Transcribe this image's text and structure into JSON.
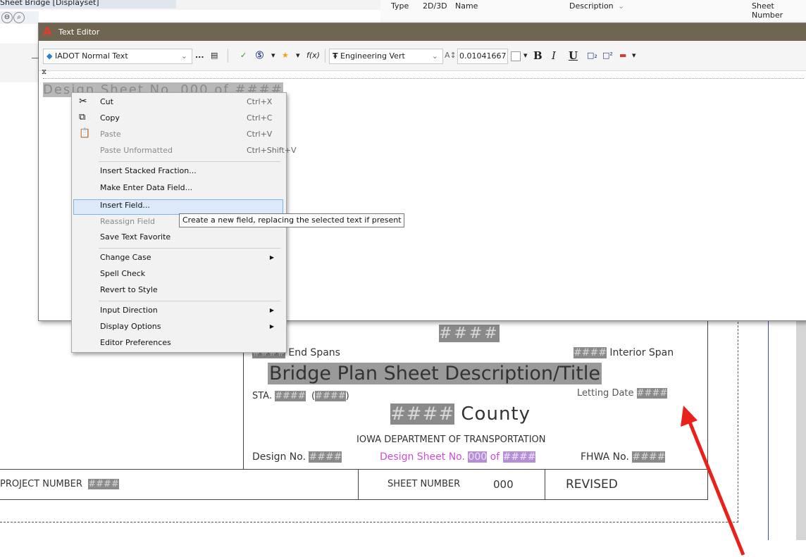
{
  "background": {
    "title_text": "Sheet Bridge [Displayset]",
    "column_headers": [
      "Type",
      "2D/3D",
      "Name",
      "Description",
      "Sheet Number"
    ]
  },
  "editor": {
    "title": "Text Editor",
    "style_name": "IADOT Normal Text",
    "font_name": "Engineering Vert",
    "text_height": "0.01041667",
    "ellipsis": "...",
    "bold_label": "B",
    "italic_label": "I",
    "underline_label": "U",
    "text_content_prefix": "Design Sheet No. ",
    "text_content_field1": "000",
    "text_content_mid": " of ",
    "text_content_field2": "####"
  },
  "context_menu": {
    "items": [
      {
        "label": "Cut",
        "shortcut": "Ctrl+X"
      },
      {
        "label": "Copy",
        "shortcut": "Ctrl+C"
      },
      {
        "label": "Paste",
        "shortcut": "Ctrl+V"
      },
      {
        "label": "Paste Unformatted",
        "shortcut": "Ctrl+Shift+V"
      },
      {
        "label": "Insert Stacked Fraction..."
      },
      {
        "label": "Make Enter Data Field..."
      },
      {
        "label": "Insert Field..."
      },
      {
        "label": "Reassign Field"
      },
      {
        "label": "Save Text Favorite"
      },
      {
        "label": "Change Case"
      },
      {
        "label": "Spell Check"
      },
      {
        "label": "Revert to Style"
      },
      {
        "label": "Input Direction"
      },
      {
        "label": "Display Options"
      },
      {
        "label": "Editor Preferences"
      }
    ],
    "tooltip": "Create a new field, replacing the selected text if present"
  },
  "sheet": {
    "hash": "####",
    "end_spans": "End Spans",
    "interior_span": "Interior Span",
    "title": "Bridge Plan Sheet Description/Title",
    "sta": "STA.",
    "letting_date": "Letting Date",
    "county": "County",
    "dept": "IOWA DEPARTMENT OF TRANSPORTATION",
    "design_no": "Design No.",
    "design_sheet_no": "Design Sheet No.",
    "sheet_of": "of",
    "zero": "000",
    "fhwa_no": "FHWA No."
  },
  "title_block": {
    "project_number_label": "PROJECT NUMBER",
    "project_number_value": "####",
    "sheet_number_label": "SHEET NUMBER",
    "sheet_number_value": "000",
    "revised_label": "REVISED"
  },
  "colors": {
    "annotation_arrow": "#e8221b",
    "highlight_field": "#cc33cc"
  }
}
